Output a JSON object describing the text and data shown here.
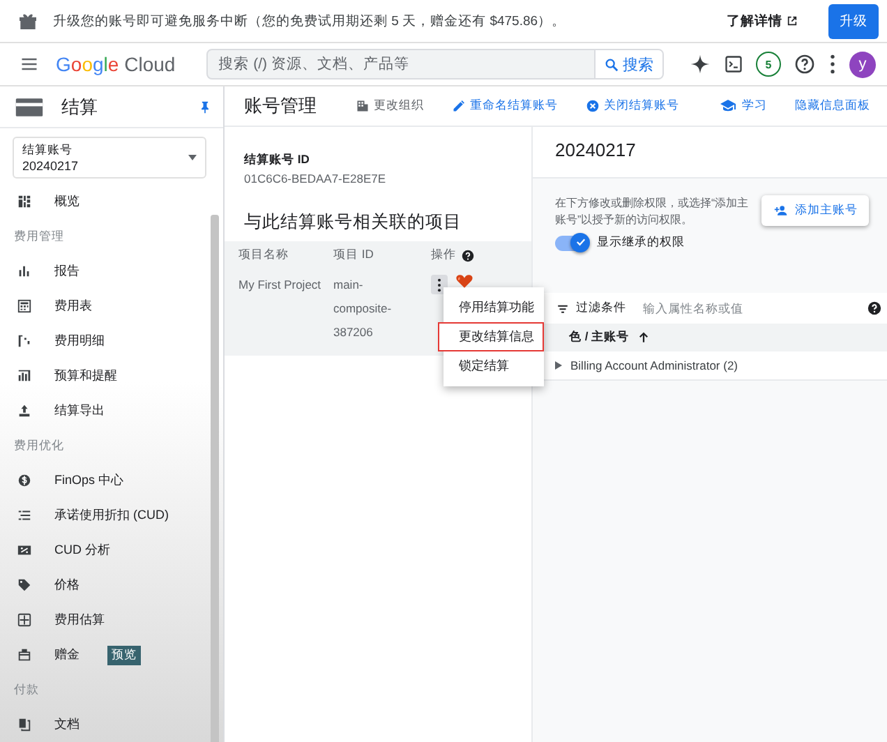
{
  "banner": {
    "message": "升级您的账号即可避免服务中断（您的免费试用期还剩 5 天，赠金还有 $475.86）。",
    "learn_more": "了解详情",
    "upgrade": "升级"
  },
  "topbar": {
    "logo_google": "Google",
    "logo_cloud": "Cloud",
    "search_placeholder": "搜索 (/) 资源、文档、产品等",
    "search_button": "搜索",
    "badge": "5",
    "avatar": "y"
  },
  "sidebar": {
    "title": "结算",
    "account_label": "结算账号",
    "account_value": "20240217",
    "items": [
      {
        "kind": "item",
        "label": "概览"
      },
      {
        "kind": "section",
        "label": "费用管理"
      },
      {
        "kind": "item",
        "label": "报告"
      },
      {
        "kind": "item",
        "label": "费用表"
      },
      {
        "kind": "item",
        "label": "费用明细"
      },
      {
        "kind": "item",
        "label": "预算和提醒"
      },
      {
        "kind": "item",
        "label": "结算导出"
      },
      {
        "kind": "section",
        "label": "费用优化"
      },
      {
        "kind": "item",
        "label": "FinOps 中心"
      },
      {
        "kind": "item",
        "label": "承诺使用折扣 (CUD)"
      },
      {
        "kind": "item",
        "label": "CUD 分析"
      },
      {
        "kind": "item",
        "label": "价格"
      },
      {
        "kind": "item",
        "label": "费用估算"
      },
      {
        "kind": "item",
        "label": "赠金",
        "badge": "预览"
      },
      {
        "kind": "section",
        "label": "付款"
      },
      {
        "kind": "item",
        "label": "文档"
      }
    ]
  },
  "header": {
    "title": "账号管理",
    "actions": [
      {
        "kind": "muted",
        "label": "更改组织"
      },
      {
        "kind": "link",
        "label": "重命名结算账号"
      },
      {
        "kind": "link",
        "label": "关闭结算账号"
      }
    ],
    "right_actions": [
      {
        "kind": "learn",
        "label": "学习"
      },
      {
        "kind": "plain",
        "label": "隐藏信息面板"
      }
    ]
  },
  "account": {
    "id_label": "结算账号 ID",
    "id_value": "01C6C6-BEDAA7-E28E7E"
  },
  "projects": {
    "title": "与此结算账号相关联的项目",
    "columns": [
      "项目名称",
      "项目 ID",
      "操作"
    ],
    "rows": [
      {
        "name": "My First Project",
        "id": "main-composite-387206"
      }
    ]
  },
  "menu": {
    "items": [
      {
        "label": "停用结算功能",
        "selected": false
      },
      {
        "label": "更改结算信息",
        "selected": true
      },
      {
        "label": "锁定结算",
        "selected": false
      }
    ]
  },
  "panel": {
    "title": "20240217",
    "description": "在下方修改或删除权限，或选择“添加主账号”以授予新的访问权限。",
    "add_button": "添加主账号",
    "toggle": {
      "label": "显示继承的权限",
      "on": true
    },
    "filter": {
      "label": "过滤条件",
      "placeholder": "输入属性名称或值"
    },
    "column": "色 / 主账号",
    "rows": [
      {
        "label": "Billing Account Administrator (2)",
        "expanded": false
      }
    ]
  }
}
